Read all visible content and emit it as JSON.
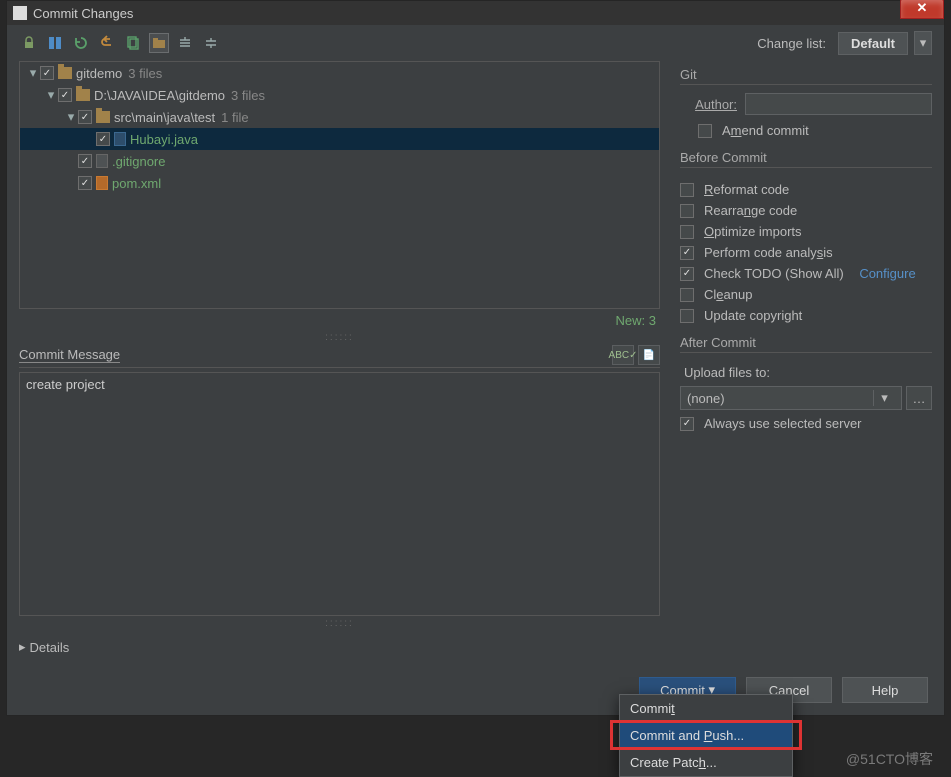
{
  "window": {
    "title": "Commit Changes"
  },
  "toolbar": {
    "change_list_label": "Change list:",
    "change_list_value": "Default"
  },
  "tree": {
    "root": {
      "label": "gitdemo",
      "suffix": "3 files"
    },
    "project": {
      "label": "D:\\JAVA\\IDEA\\gitdemo",
      "suffix": "3 files"
    },
    "srcdir": {
      "label": "src\\main\\java\\test",
      "suffix": "1 file"
    },
    "java_file": {
      "label": "Hubayi.java"
    },
    "gitignore": {
      "label": ".gitignore"
    },
    "pom": {
      "label": "pom.xml"
    },
    "status": "New: 3"
  },
  "commit": {
    "header": "Commit Message",
    "message": "create project",
    "details": "Details"
  },
  "right": {
    "git": "Git",
    "author_label": "Author:",
    "author_value": "",
    "amend": "Amend commit",
    "before": "Before Commit",
    "reformat": "Reformat code",
    "rearrange": "Rearrange code",
    "optimize": "Optimize imports",
    "analysis": "Perform code analysis",
    "todo": "Check TODO (Show All)",
    "configure": "Configure",
    "cleanup": "Cleanup",
    "copyright": "Update copyright",
    "after": "After Commit",
    "upload": "Upload files to:",
    "upload_val": "(none)",
    "always": "Always use selected server"
  },
  "buttons": {
    "commit": "Commit",
    "cancel": "Cancel",
    "help": "Help"
  },
  "popup": {
    "commit": "Commit",
    "commit_push": "Commit and Push...",
    "patch": "Create Patch..."
  },
  "watermark": "@51CTO博客"
}
